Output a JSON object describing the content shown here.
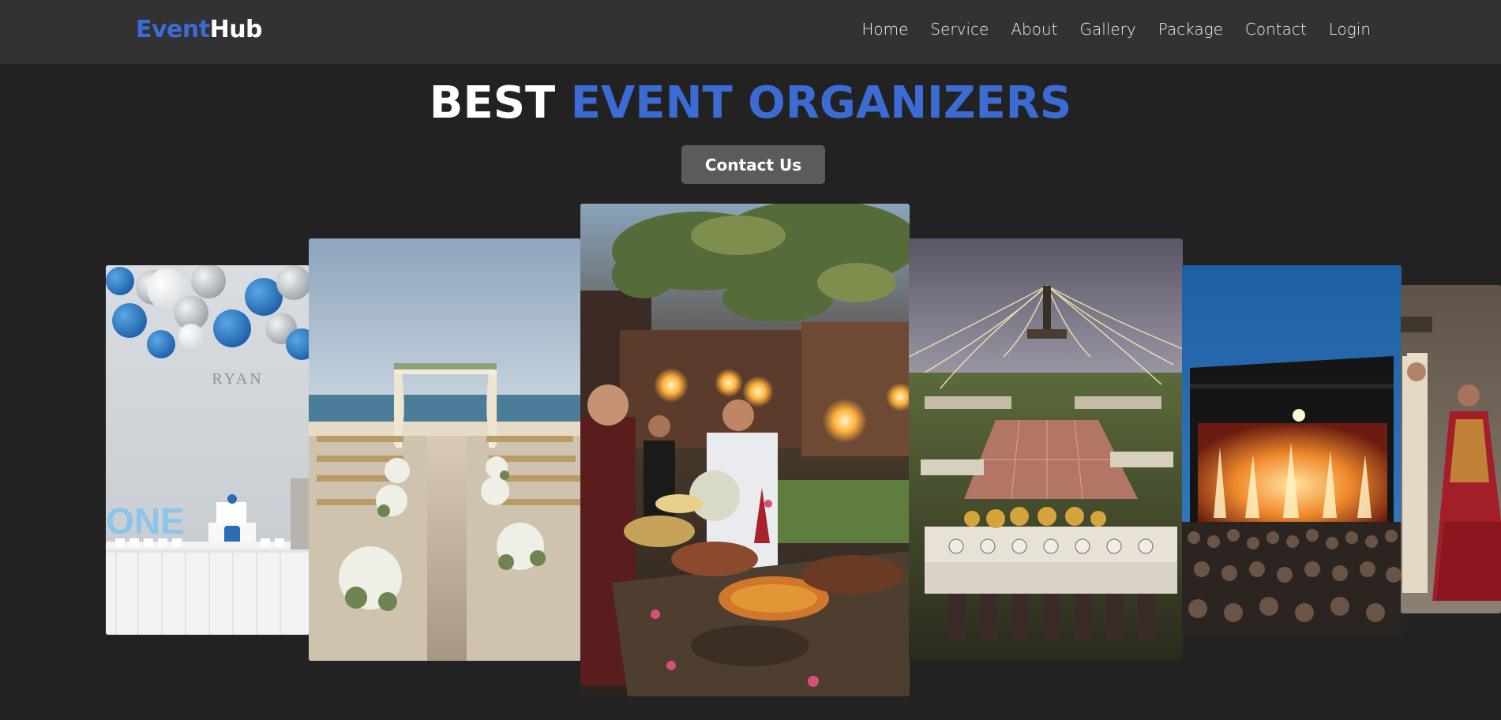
{
  "brand": {
    "part1": "Event",
    "part2": "Hub"
  },
  "nav": {
    "items": [
      {
        "label": "Home"
      },
      {
        "label": "Service"
      },
      {
        "label": "About"
      },
      {
        "label": "Gallery"
      },
      {
        "label": "Package"
      },
      {
        "label": "Contact"
      },
      {
        "label": "Login"
      }
    ]
  },
  "hero": {
    "title_white": "BEST ",
    "title_blue": "EVENT ORGANIZERS",
    "cta_label": "Contact Us"
  },
  "gallery": {
    "birthday_name_text": "RYAN",
    "birthday_sign_text": "ONE"
  },
  "colors": {
    "accent": "#3d6bd4",
    "background": "#222222",
    "navbar": "#323232",
    "button": "#5b5b5b"
  }
}
